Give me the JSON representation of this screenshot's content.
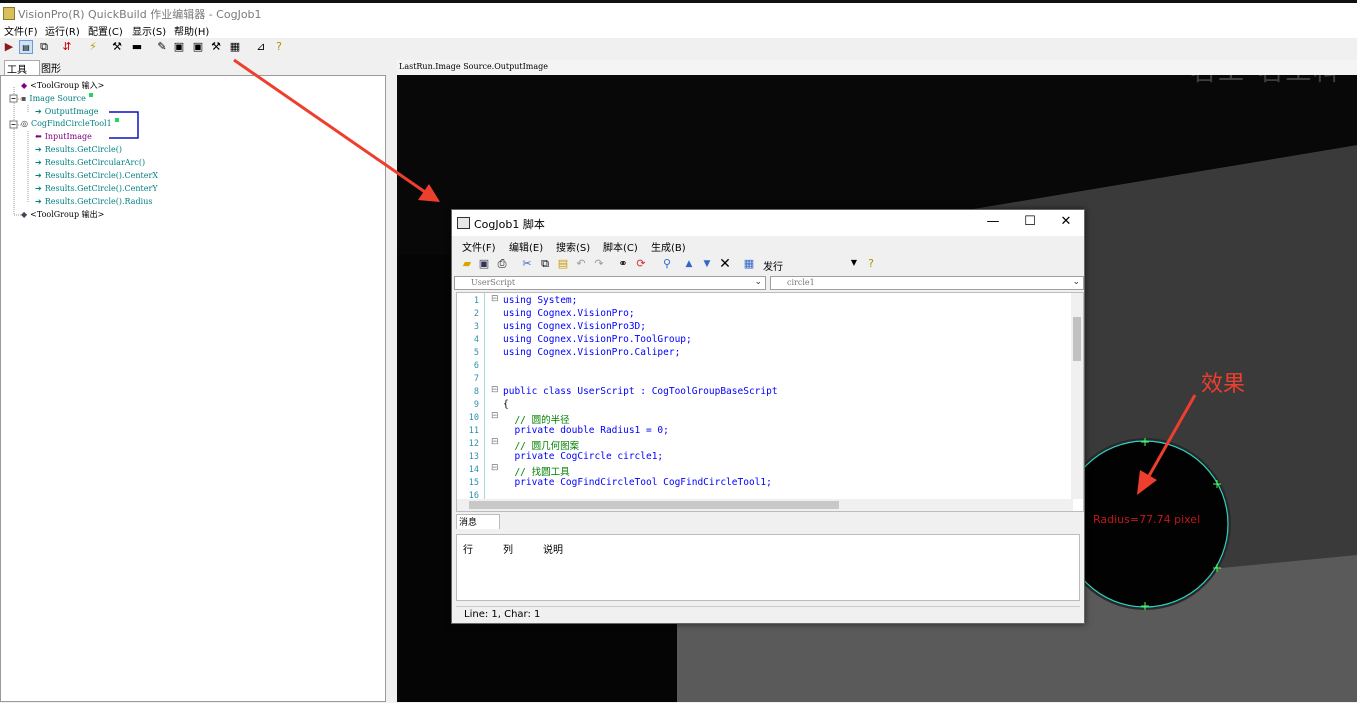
{
  "window": {
    "title": "VisionPro(R) QuickBuild 作业编辑器 - CogJob1",
    "menu": [
      "文件(F)",
      "运行(R)",
      "配置(C)",
      "显示(S)",
      "帮助(H)"
    ]
  },
  "left_pane": {
    "tabs": [
      "工具",
      "图形"
    ],
    "tree": [
      "<ToolGroup 输入>",
      "Image Source",
      "OutputImage",
      "CogFindCircleTool1",
      "InputImage",
      "Results.GetCircle()",
      "Results.GetCircularArc()",
      "Results.GetCircle().CenterX",
      "Results.GetCircle().CenterY",
      "Results.GetCircle().Radius",
      "<ToolGroup 输出>"
    ]
  },
  "image_view": {
    "header": "LastRun.Image Source.OutputImage",
    "watermark": "茗工-茗工科",
    "annotation": "效果",
    "radius_label": "Radius=77.74 pixel"
  },
  "script_window": {
    "title": "CogJob1 脚本",
    "menu": [
      "文件(F)",
      "编辑(E)",
      "搜索(S)",
      "脚本(C)",
      "生成(B)"
    ],
    "build_config": "发行",
    "class_combo": "UserScript",
    "member_combo": "circle1",
    "code_lines": [
      {
        "n": "1",
        "text": "using System;"
      },
      {
        "n": "2",
        "text": "using Cognex.VisionPro;"
      },
      {
        "n": "3",
        "text": "using Cognex.VisionPro3D;"
      },
      {
        "n": "4",
        "text": "using Cognex.VisionPro.ToolGroup;"
      },
      {
        "n": "5",
        "text": "using Cognex.VisionPro.Caliper;"
      },
      {
        "n": "6",
        "text": ""
      },
      {
        "n": "7",
        "text": ""
      },
      {
        "n": "8",
        "text": "public class UserScript : CogToolGroupBaseScript"
      },
      {
        "n": "9",
        "text": "{"
      },
      {
        "n": "10",
        "text": "  // 圆的半径"
      },
      {
        "n": "11",
        "text": "  private double Radius1 = 0;"
      },
      {
        "n": "12",
        "text": "  // 圆几何图案"
      },
      {
        "n": "13",
        "text": "  private CogCircle circle1;"
      },
      {
        "n": "14",
        "text": "  // 找圆工具"
      },
      {
        "n": "15",
        "text": "  private CogFindCircleTool CogFindCircleTool1;"
      },
      {
        "n": "16",
        "text": ""
      }
    ],
    "messages_tab": "消息",
    "messages_columns": [
      "行",
      "列",
      "说明"
    ],
    "status": "Line: 1, Char: 1"
  },
  "colors": {
    "annotation": "#ee3e2e",
    "circle": "#2fd3c4",
    "tree_text": "#008080",
    "input_arrow": "#800080"
  }
}
